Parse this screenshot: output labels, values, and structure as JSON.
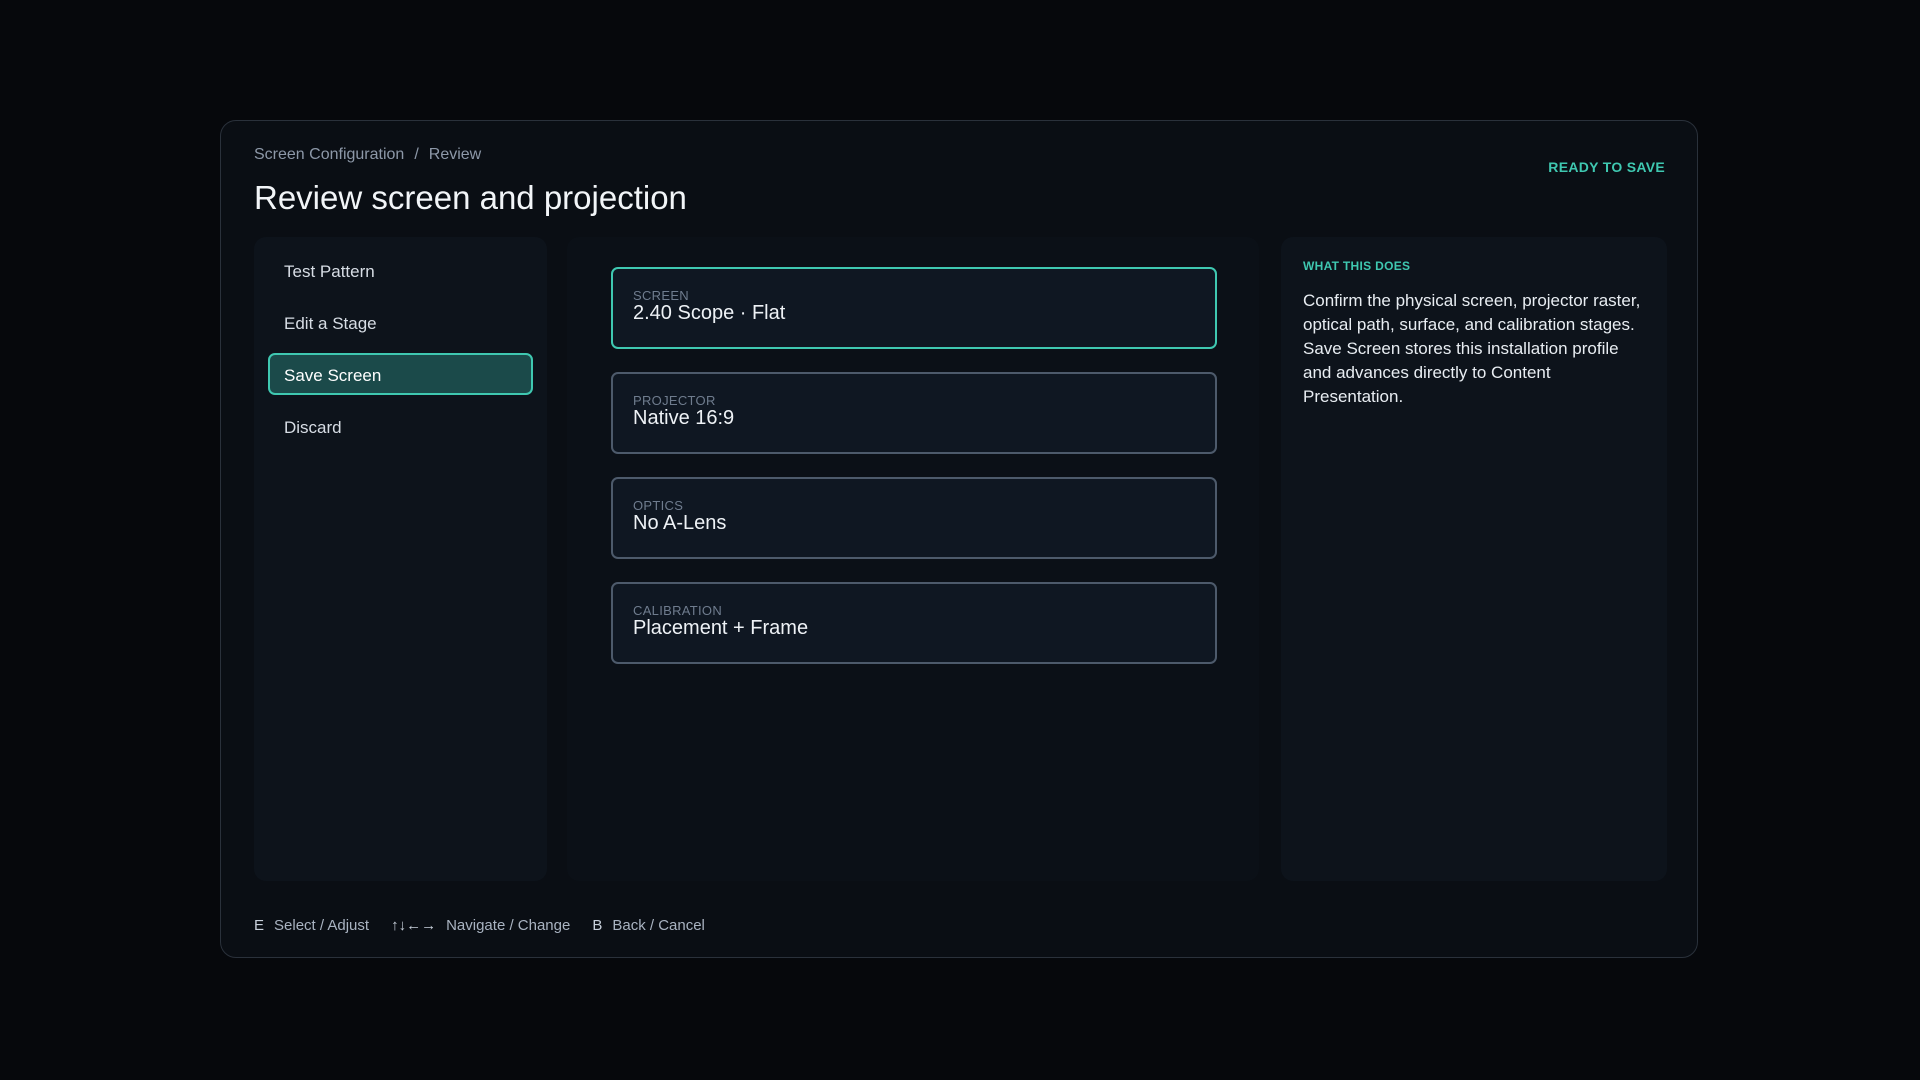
{
  "breadcrumb": {
    "root": "Screen Configuration",
    "separator": "/",
    "current": "Review"
  },
  "status": "READY TO SAVE",
  "title": "Review screen and projection",
  "sidebar": {
    "items": [
      {
        "label": "Test Pattern",
        "active": false
      },
      {
        "label": "Edit a Stage",
        "active": false
      },
      {
        "label": "Save Screen",
        "active": true
      },
      {
        "label": "Discard",
        "active": false
      }
    ]
  },
  "cards": [
    {
      "label": "SCREEN",
      "value": "2.40 Scope · Flat",
      "focused": true
    },
    {
      "label": "PROJECTOR",
      "value": "Native 16:9",
      "focused": false
    },
    {
      "label": "OPTICS",
      "value": "No A-Lens",
      "focused": false
    },
    {
      "label": "CALIBRATION",
      "value": "Placement + Frame",
      "focused": false
    }
  ],
  "info": {
    "heading": "WHAT THIS DOES",
    "body": "Confirm the physical screen, projector raster, optical path, surface, and calibration stages. Save Screen stores this installation profile and advances directly to Content Presentation."
  },
  "footer": {
    "hints": [
      {
        "key": "E",
        "action": "Select / Adjust"
      },
      {
        "key": "↑↓←→",
        "action": "Navigate / Change"
      },
      {
        "key": "B",
        "action": "Back / Cancel"
      }
    ]
  },
  "colors": {
    "accent": "#3fc8b1",
    "background": "#06080c",
    "panel": "#0d131b",
    "active_item": "#1b4a4a"
  }
}
